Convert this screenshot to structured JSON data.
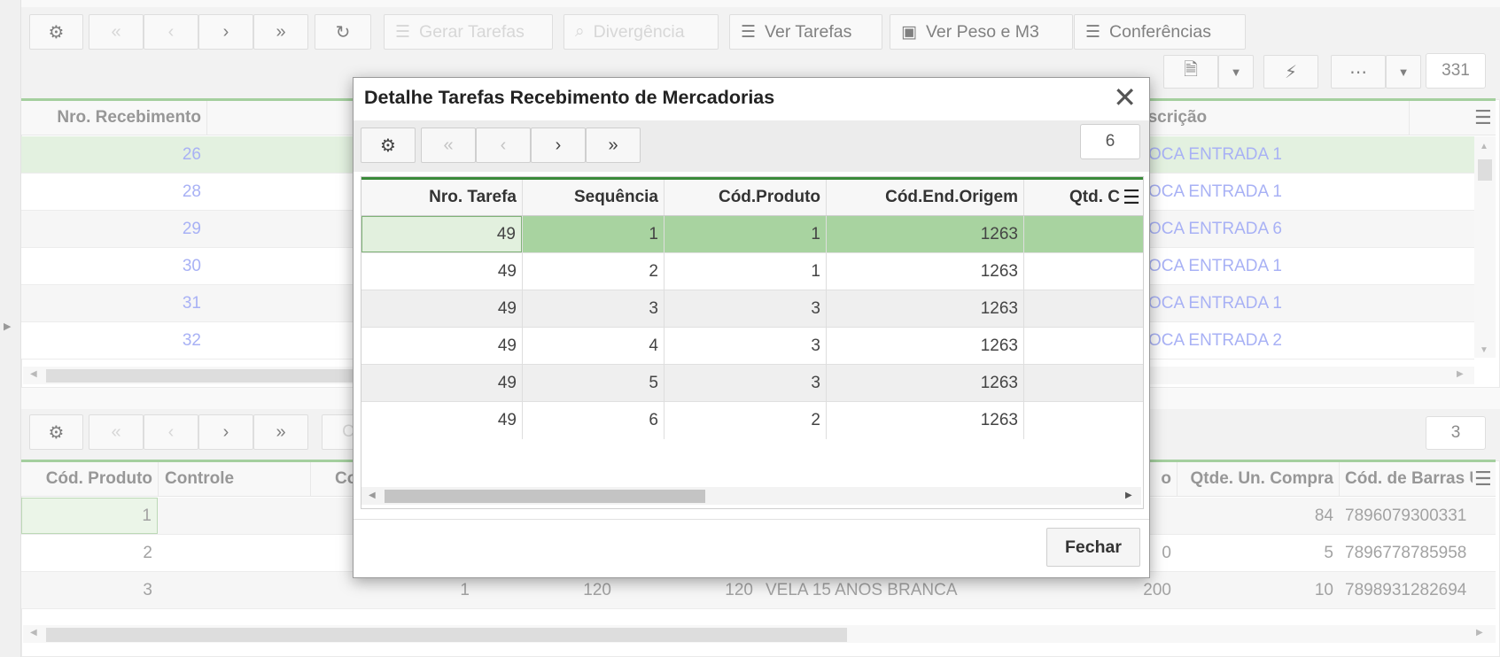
{
  "top_toolbar": {
    "gerar_tarefas": "Gerar Tarefas",
    "divergencia": "Divergência",
    "ver_tarefas": "Ver Tarefas",
    "ver_peso": "Ver Peso e M3",
    "conferencias": "Conferências",
    "record_count": "331"
  },
  "top_grid": {
    "headers": {
      "nro_recebimento": "Nro. Recebimento",
      "descricao": "escrição"
    },
    "rows": [
      {
        "nro": "26",
        "desc": "OCA ENTRADA 1"
      },
      {
        "nro": "28",
        "desc": "OCA ENTRADA 1"
      },
      {
        "nro": "29",
        "desc": "OCA ENTRADA 6"
      },
      {
        "nro": "30",
        "desc": "OCA ENTRADA 1"
      },
      {
        "nro": "31",
        "desc": "OCA ENTRADA 1"
      },
      {
        "nro": "32",
        "desc": "OCA ENTRADA 2"
      }
    ]
  },
  "bottom_toolbar": {
    "record_count": "3",
    "partial_label": "C"
  },
  "bottom_grid": {
    "headers": {
      "cod_produto": "Cód. Produto",
      "controle": "Controle",
      "partial_c": "Co",
      "partial_o": "o",
      "qtde_un_compra": "Qtde. Un. Compra",
      "cod_barras": "Cód. de Barras Ur"
    },
    "rows": [
      {
        "cod": "1",
        "col3": "",
        "col4": "",
        "col5": "",
        "desc": "",
        "col7": "",
        "qtde": "84",
        "barras": "7896079300331"
      },
      {
        "cod": "2",
        "col3": "",
        "col4": "",
        "col5": "",
        "desc": "",
        "col7": "0",
        "qtde": "5",
        "barras": "7896778785958"
      },
      {
        "cod": "3",
        "col3": "1",
        "col4": "120",
        "col5": "120",
        "desc": "VELA 15 ANOS BRANCA",
        "col7": "200",
        "qtde": "10",
        "barras": "7898931282694"
      }
    ]
  },
  "modal": {
    "title": "Detalhe Tarefas Recebimento de Mercadorias",
    "record_count": "6",
    "headers": {
      "nro_tarefa": "Nro. Tarefa",
      "sequencia": "Sequência",
      "cod_produto": "Cód.Produto",
      "cod_end_origem": "Cód.End.Origem",
      "qtd": "Qtd. C"
    },
    "rows": [
      {
        "tarefa": "49",
        "seq": "1",
        "prod": "1",
        "origem": "1263"
      },
      {
        "tarefa": "49",
        "seq": "2",
        "prod": "1",
        "origem": "1263"
      },
      {
        "tarefa": "49",
        "seq": "3",
        "prod": "3",
        "origem": "1263"
      },
      {
        "tarefa": "49",
        "seq": "4",
        "prod": "3",
        "origem": "1263"
      },
      {
        "tarefa": "49",
        "seq": "5",
        "prod": "3",
        "origem": "1263"
      },
      {
        "tarefa": "49",
        "seq": "6",
        "prod": "2",
        "origem": "1263"
      }
    ],
    "fechar_label": "Fechar"
  },
  "colors": {
    "accent_green": "#79b870",
    "selected_row": "#a8d3a0",
    "link_blue": "#7f8df0"
  }
}
